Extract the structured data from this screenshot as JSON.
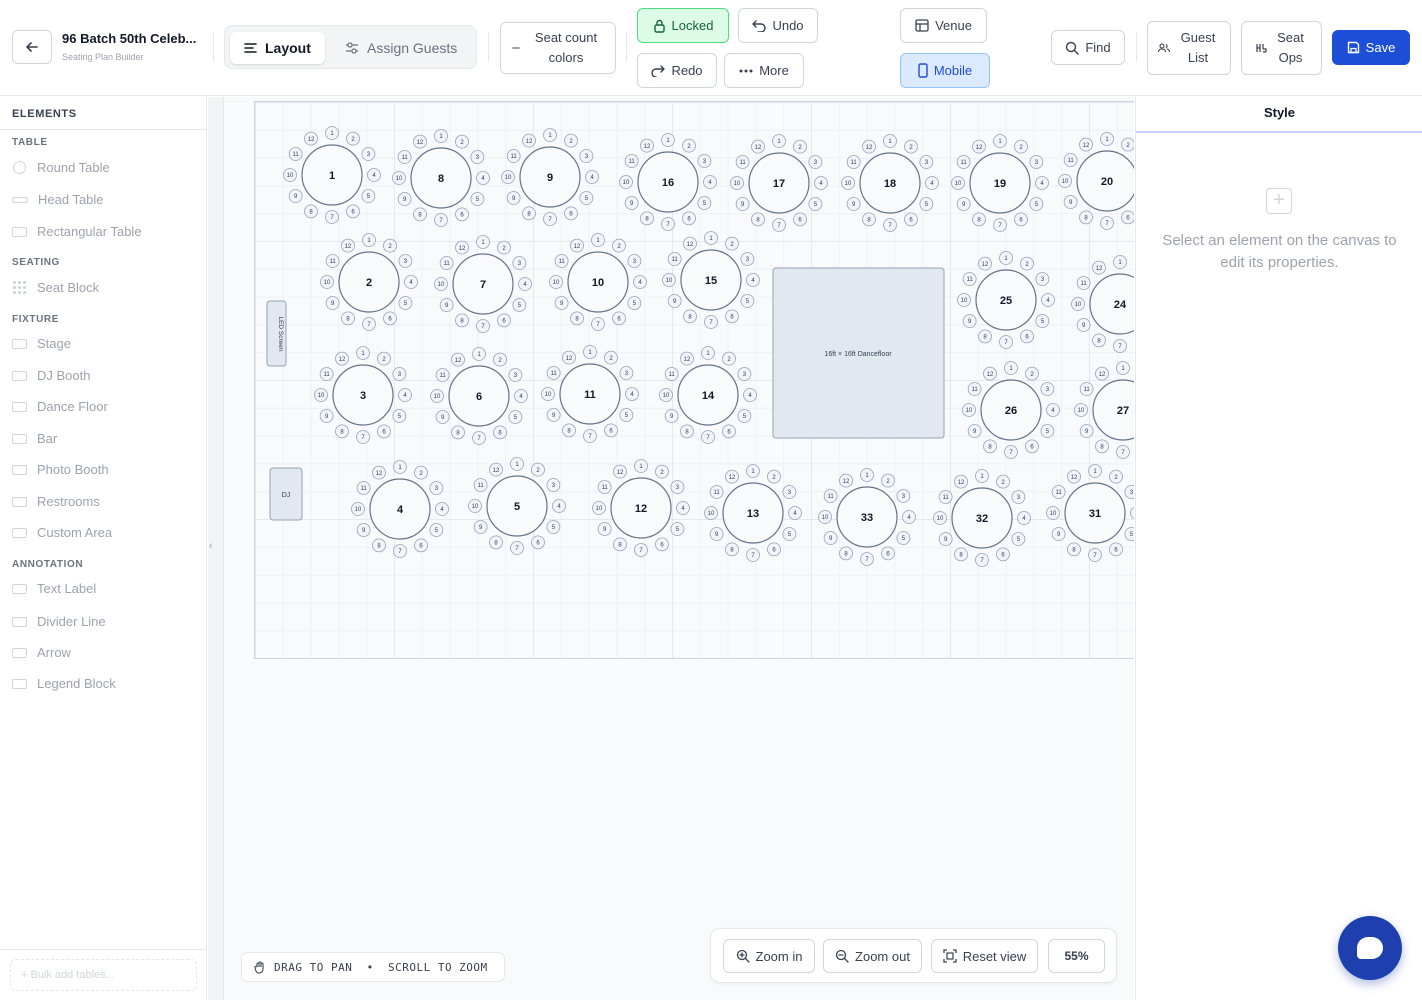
{
  "header": {
    "title": "96 Batch 50th Celeb...",
    "subtitle": "Seating Plan Builder",
    "tabs": [
      {
        "label": "Layout",
        "active": true
      },
      {
        "label": "Assign Guests",
        "active": false
      }
    ],
    "seat_count_colors": "Seat count colors",
    "locked": "Locked",
    "undo": "Undo",
    "redo": "Redo",
    "more": "More",
    "venue": "Venue",
    "mobile": "Mobile",
    "find": "Find",
    "guest_list": "Guest List",
    "seat_ops": "Seat Ops",
    "save": "Save"
  },
  "sidebar": {
    "header": "ELEMENTS",
    "sections": [
      {
        "title": "TABLE",
        "items": [
          {
            "label": "Round Table",
            "icon": "round-table-icon"
          },
          {
            "label": "Head Table",
            "icon": "head-table-icon"
          },
          {
            "label": "Rectangular Table",
            "icon": "rect-table-icon"
          }
        ]
      },
      {
        "title": "SEATING",
        "items": [
          {
            "label": "Seat Block",
            "icon": "seat-block-icon"
          }
        ]
      },
      {
        "title": "FIXTURE",
        "items": [
          {
            "label": "Stage",
            "icon": "stage-icon"
          },
          {
            "label": "DJ Booth",
            "icon": "dj-booth-icon"
          },
          {
            "label": "Dance Floor",
            "icon": "dance-floor-icon"
          },
          {
            "label": "Bar",
            "icon": "bar-icon"
          },
          {
            "label": "Photo Booth",
            "icon": "photo-booth-icon"
          },
          {
            "label": "Restrooms",
            "icon": "restrooms-icon"
          },
          {
            "label": "Custom Area",
            "icon": "custom-area-icon"
          }
        ]
      },
      {
        "title": "ANNOTATION",
        "items": [
          {
            "label": "Text Label",
            "icon": "text-label-icon"
          },
          {
            "label": "Divider Line",
            "icon": "divider-line-icon"
          },
          {
            "label": "Arrow",
            "icon": "arrow-icon"
          },
          {
            "label": "Legend Block",
            "icon": "legend-block-icon"
          }
        ]
      }
    ],
    "bulk_add": "+ Bulk add tables..."
  },
  "canvas": {
    "dancefloor_label": "16ft × 16ft Dancefloor",
    "led_label": "LED Screen",
    "dj_label": "DJ",
    "seats_per_table": 12,
    "tables": [
      {
        "number": "1"
      },
      {
        "number": "8"
      },
      {
        "number": "9"
      },
      {
        "number": "16"
      },
      {
        "number": "17"
      },
      {
        "number": "18"
      },
      {
        "number": "19"
      },
      {
        "number": "20"
      },
      {
        "number": "2"
      },
      {
        "number": "7"
      },
      {
        "number": "10"
      },
      {
        "number": "15"
      },
      {
        "number": "25"
      },
      {
        "number": "24"
      },
      {
        "number": "3"
      },
      {
        "number": "6"
      },
      {
        "number": "11"
      },
      {
        "number": "14"
      },
      {
        "number": "26"
      },
      {
        "number": "27"
      },
      {
        "number": "4"
      },
      {
        "number": "5"
      },
      {
        "number": "12"
      },
      {
        "number": "13"
      },
      {
        "number": "33"
      },
      {
        "number": "32"
      },
      {
        "number": "31"
      }
    ],
    "hint": "DRAG TO PAN  •  SCROLL TO ZOOM",
    "zoom_in": "Zoom in",
    "zoom_out": "Zoom out",
    "reset_view": "Reset view",
    "zoom_level": "55%"
  },
  "right_panel": {
    "tab": "Style",
    "empty_message": "Select an element on the canvas to edit its properties."
  },
  "colors": {
    "primary": "#1d4ed8",
    "locked_bg": "#dcfce7",
    "mobile_bg": "#dbeafe"
  }
}
